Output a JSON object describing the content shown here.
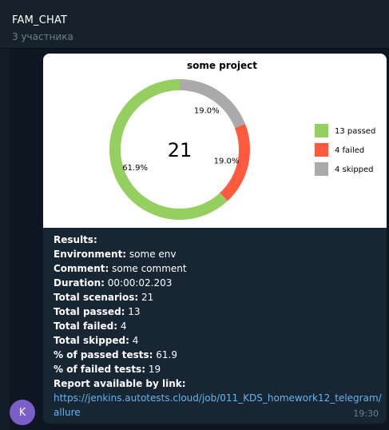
{
  "header": {
    "title": "FAM_CHAT",
    "subtitle": "3 участника"
  },
  "message": {
    "lines": [
      {
        "label": "Results:",
        "value": ""
      },
      {
        "label": "Environment:",
        "value": "some env"
      },
      {
        "label": "Comment:",
        "value": "some comment"
      },
      {
        "label": "Duration:",
        "value": "00:00:02.203"
      },
      {
        "label": "Total scenarios:",
        "value": "21"
      },
      {
        "label": "Total passed:",
        "value": "13"
      },
      {
        "label": "Total failed:",
        "value": "4"
      },
      {
        "label": "Total skipped:",
        "value": "4"
      },
      {
        "label": "% of passed tests:",
        "value": "61.9"
      },
      {
        "label": "% of failed tests:",
        "value": "19"
      },
      {
        "label": "Report available by link:",
        "value": ""
      }
    ],
    "link": "https://jenkins.autotests.cloud/job/011_KDS_homework12_telegram/allure",
    "time": "19:30"
  },
  "avatar": {
    "letter": "K",
    "color": "#7b5fc9"
  },
  "chart_data": {
    "type": "pie",
    "title": "some project",
    "center_label": "21",
    "slices": [
      {
        "label": "13 passed",
        "value": 13,
        "percent": "61.9%",
        "color": "#94cf5f"
      },
      {
        "label": "4 failed",
        "value": 4,
        "percent": "19.0%",
        "color": "#fd5a3e"
      },
      {
        "label": "4 skipped",
        "value": 4,
        "percent": "19.0%",
        "color": "#aaaaaa"
      }
    ],
    "legend_position": "right"
  }
}
